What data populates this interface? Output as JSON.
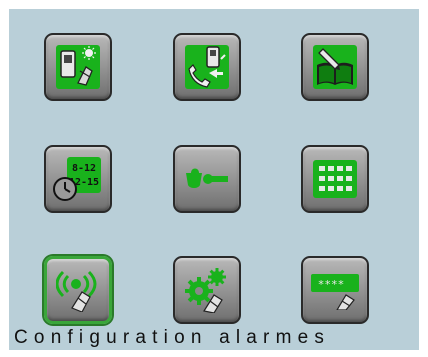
{
  "menu": {
    "icons": [
      "intercom-day-night-icon",
      "call-transfer-icon",
      "directory-book-icon",
      "schedule-clock-icon",
      "key-access-icon",
      "keypad-grid-icon",
      "alarm-signal-icon",
      "settings-gears-icon",
      "access-code-icon"
    ],
    "selected_index": 6
  },
  "caption": "Configuration alarmes",
  "colors": {
    "background": "#b9cfd8",
    "icon_green": "#19b21c",
    "selected_border": "#3aa63a"
  }
}
